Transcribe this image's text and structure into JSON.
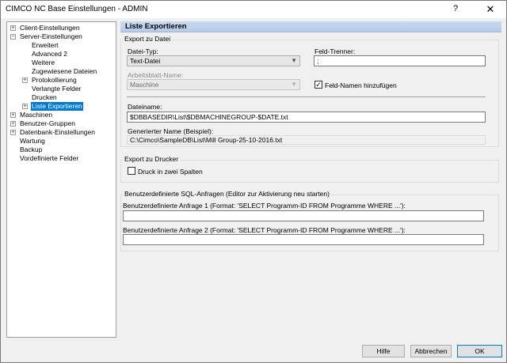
{
  "window": {
    "title": "CIMCO NC Base Einstellungen - ADMIN",
    "help_glyph": "?",
    "close_glyph": "✕"
  },
  "tree": {
    "client": "Client-Einstellungen",
    "server": "Server-Einstellungen",
    "erweitert": "Erweitert",
    "advanced2": "Advanced 2",
    "weitere": "Weitere",
    "zugewiesene": "Zugewiesene Dateien",
    "protokollierung": "Protokollierung",
    "verlangte": "Verlangte Felder",
    "drucken": "Drucken",
    "liste_exportieren": "Liste Exportieren",
    "maschinen": "Maschinen",
    "benutzer_gruppen": "Benutzer-Gruppen",
    "datenbank": "Datenbank-Einstellungen",
    "wartung": "Wartung",
    "backup": "Backup",
    "vordefinierte": "Vordefinierte Felder",
    "expand_glyph": "+",
    "collapse_glyph": "−"
  },
  "panel": {
    "title": "Liste Exportieren",
    "export_datei": {
      "group_title": "Export zu Datei",
      "datei_typ_label": "Datei-Typ:",
      "datei_typ_value": "Text-Datei",
      "feld_trenner_label": "Feld-Trenner:",
      "feld_trenner_value": ";",
      "arbeitsblatt_label": "Arbeitsblatt-Name:",
      "arbeitsblatt_value": "Maschine",
      "feld_namen_label": "Feld-Namen hinzufügen",
      "feld_namen_checked": "✓",
      "dateiname_label": "Dateiname:",
      "dateiname_value": "$DBBASEDIR\\List\\$DBMACHINEGROUP-$DATE.txt",
      "generiert_label": "Generierter Name (Beispiel):",
      "generiert_value": "C:\\Cimco\\SampleDB\\List\\Mill Group-25-10-2016.txt"
    },
    "export_drucker": {
      "group_title": "Export zu Drucker",
      "zwei_spalten_label": "Druck in zwei Spalten"
    },
    "sql": {
      "group_title": "Benutzerdefinierte SQL-Anfragen (Editor zur Aktivierung neu starten)",
      "anfrage1_label": "Benutzerdefinierte Anfrage 1 (Format: 'SELECT Programm-ID FROM Programme WHERE ...'):",
      "anfrage1_value": "",
      "anfrage2_label": "Benutzerdefinierte Anfrage 2 (Format: 'SELECT Programm-ID FROM Programme WHERE ...'):",
      "anfrage2_value": ""
    },
    "dropdown_arrow": "▼"
  },
  "buttons": {
    "hilfe": "Hilfe",
    "abbrechen": "Abbrechen",
    "ok": "OK"
  }
}
